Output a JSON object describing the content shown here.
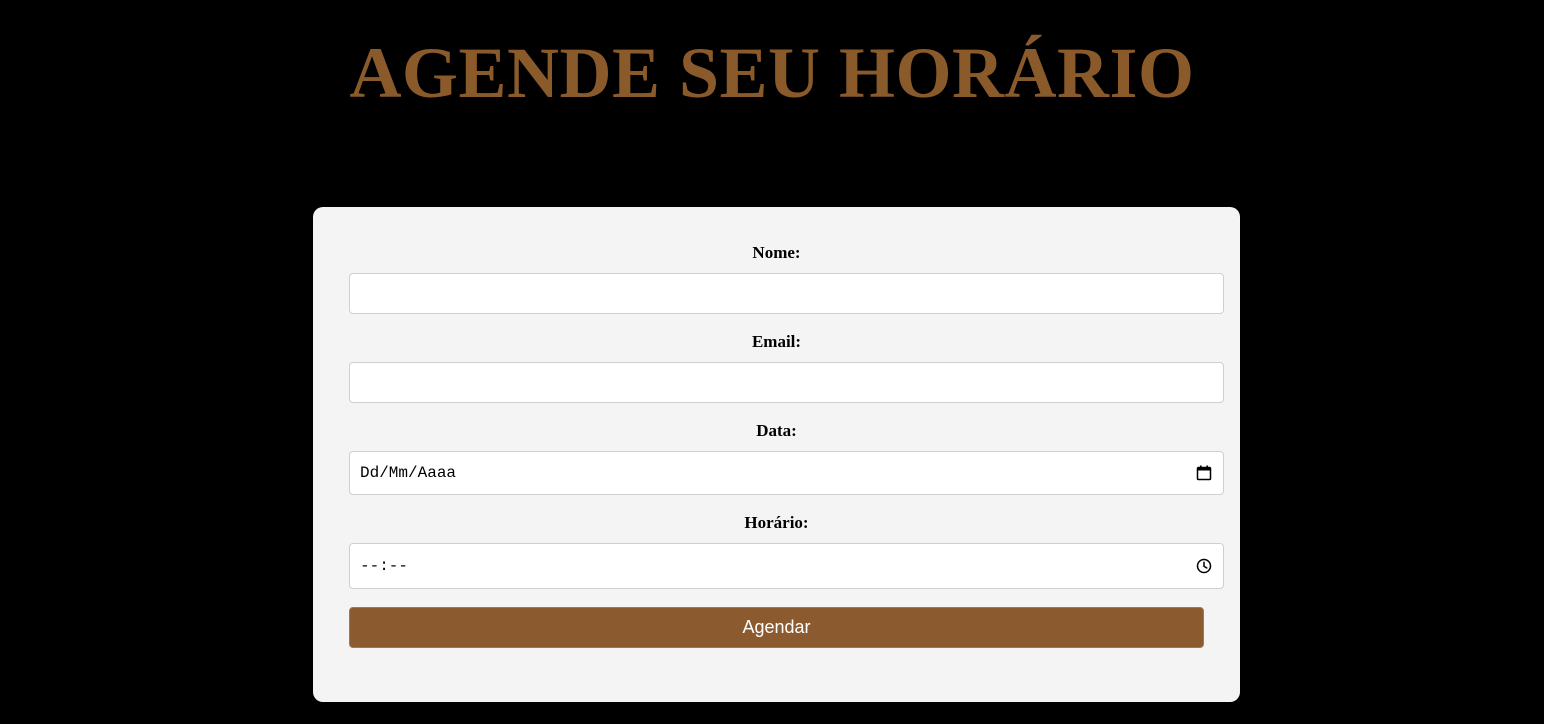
{
  "page": {
    "title": "AGENDE SEU HORÁRIO"
  },
  "form": {
    "fields": [
      {
        "label": "Nome:",
        "value": ""
      },
      {
        "label": "Email:",
        "value": ""
      },
      {
        "label": "Data:",
        "value": "Dd/Mm/Aaaa",
        "icon": "calendar-icon"
      },
      {
        "label": "Horário:",
        "value": "--:--",
        "icon": "clock-icon"
      }
    ],
    "submit_label": "Agendar"
  },
  "colors": {
    "background": "#000000",
    "accent": "#8b5a2b",
    "card": "#f4f4f4"
  }
}
